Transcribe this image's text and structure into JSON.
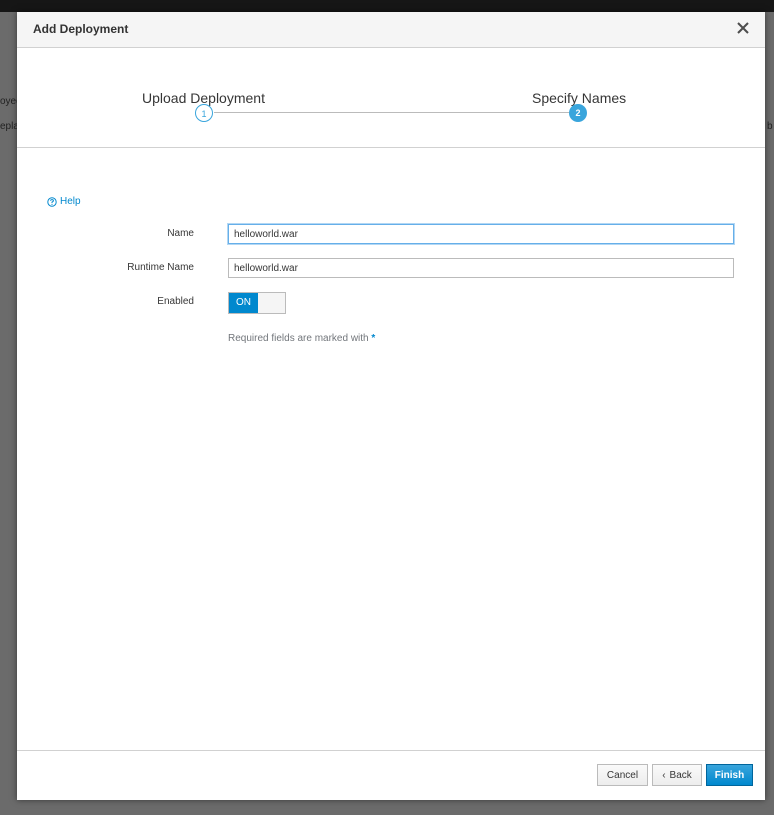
{
  "background": {
    "text_left_1": "oyed",
    "text_left_2": "epla",
    "text_right": "b"
  },
  "modal": {
    "title": "Add Deployment",
    "close_icon": "close-icon"
  },
  "wizard": {
    "steps": [
      {
        "label": "Upload Deployment",
        "number": "1",
        "state": "completed"
      },
      {
        "label": "Specify Names",
        "number": "2",
        "state": "active"
      }
    ]
  },
  "form": {
    "help_label": "Help",
    "fields": {
      "name": {
        "label": "Name",
        "value": "helloworld.war"
      },
      "runtime_name": {
        "label": "Runtime Name",
        "value": "helloworld.war"
      },
      "enabled": {
        "label": "Enabled",
        "value": "ON"
      }
    },
    "required_note": "Required fields are marked with",
    "required_marker": "*"
  },
  "footer": {
    "cancel_label": "Cancel",
    "back_label": "Back",
    "finish_label": "Finish"
  },
  "colors": {
    "accent": "#0088ce",
    "step_accent": "#39a5dc",
    "overlay": "#6b6b6b"
  }
}
